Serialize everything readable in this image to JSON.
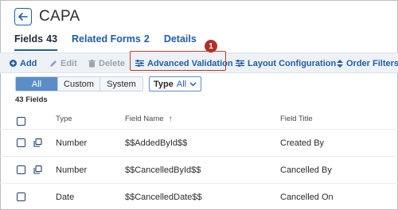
{
  "header": {
    "title": "CAPA"
  },
  "tabs": [
    {
      "label": "Fields",
      "count": "43"
    },
    {
      "label": "Related Forms",
      "count": "2"
    },
    {
      "label": "Details"
    }
  ],
  "toolbar": {
    "add": "Add",
    "edit": "Edit",
    "delete": "Delete",
    "advanced_validation": "Advanced Validation",
    "layout_configuration": "Layout Configuration",
    "order_filters": "Order Filters"
  },
  "step_badge": "1",
  "filters": {
    "segments": [
      "All",
      "Custom",
      "System"
    ],
    "type_label": "Type",
    "type_value": "All"
  },
  "field_count": "43 Fields",
  "table": {
    "headers": {
      "type": "Type",
      "field_name": "Field Name",
      "field_title": "Field Title"
    },
    "rows": [
      {
        "type": "Number",
        "field_name": "$$AddedById$$",
        "field_title": "Created By"
      },
      {
        "type": "Number",
        "field_name": "$$CancelledById$$",
        "field_title": "Cancelled By"
      },
      {
        "type": "Date",
        "field_name": "$$CancelledDate$$",
        "field_title": "Cancelled On"
      }
    ]
  },
  "colors": {
    "accent": "#1f5ea8",
    "segment_active": "#5b8ec9",
    "highlight": "#c0392b",
    "toolbar_bg": "#eef2f7"
  }
}
